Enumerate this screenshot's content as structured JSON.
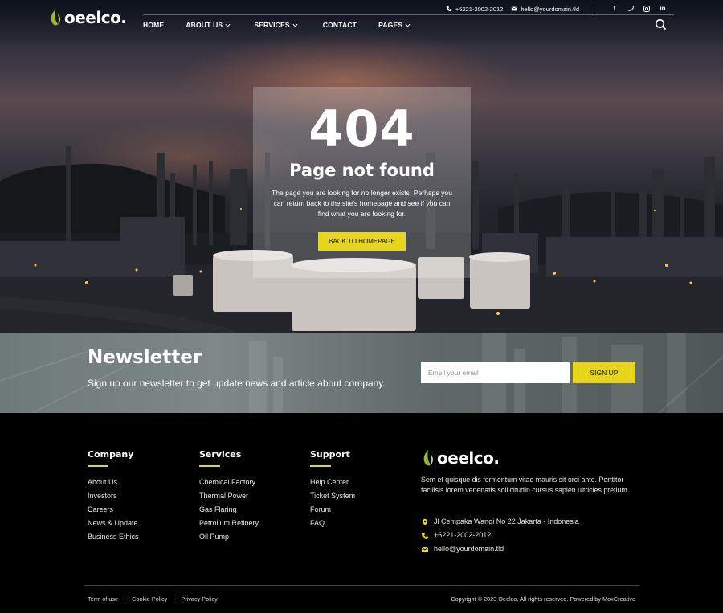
{
  "brand": {
    "name": "oeelco.",
    "accent": "#e6d51a",
    "leaf_color": "#9bb63a"
  },
  "topbar": {
    "phone": "+6221-2002-2012",
    "email": "hello@yourdomain.tld",
    "social": [
      "facebook-icon",
      "twitter-icon",
      "instagram-icon",
      "linkedin-icon"
    ]
  },
  "nav": [
    {
      "label": "HOME",
      "dropdown": false
    },
    {
      "label": "ABOUT US",
      "dropdown": true
    },
    {
      "label": "SERVICES",
      "dropdown": true
    },
    {
      "label": "CONTACT",
      "dropdown": false
    },
    {
      "label": "PAGES",
      "dropdown": true
    }
  ],
  "error": {
    "code": "404",
    "title": "Page not found",
    "message": "The page you are looking for no longer exists. Perhaps you can return back to the site's homepage and see if you can find what you are looking for.",
    "button": "BACK TO HOMEPAGE"
  },
  "newsletter": {
    "title": "Newsletter",
    "subtitle": "Sign up our newsletter to get update news and article about company.",
    "placeholder": "Email your email",
    "button": "SIGN UP"
  },
  "footer": {
    "columns": [
      {
        "heading": "Company",
        "links": [
          "About Us",
          "Investors",
          "Careers",
          "News & Update",
          "Business Ethics"
        ]
      },
      {
        "heading": "Services",
        "links": [
          "Chemical Factory",
          "Thermal Power",
          "Gas Flaring",
          "Petrolium Refinery",
          "Oil Pump"
        ]
      },
      {
        "heading": "Support",
        "links": [
          "Help Center",
          "Ticket System",
          "Forum",
          "FAQ"
        ]
      }
    ],
    "description": "Sem et quisque dis fermentum vitae mauris sit orci ante. Porttitor facilisis lorem venenatis sollicitudin cursus sapien ultricies pretium.",
    "address": "Jl Cempaka Wangi No 22 Jakarta - Indonesia",
    "phone": "+6221-2002-2012",
    "email": "hello@yourdomain.tld",
    "legal": [
      "Term of use",
      "Cookie Policy",
      "Privacy Policy"
    ],
    "copyright": "Copyright © 2023 Oeelco, All rights reserved. Powered by MoxCreative"
  }
}
